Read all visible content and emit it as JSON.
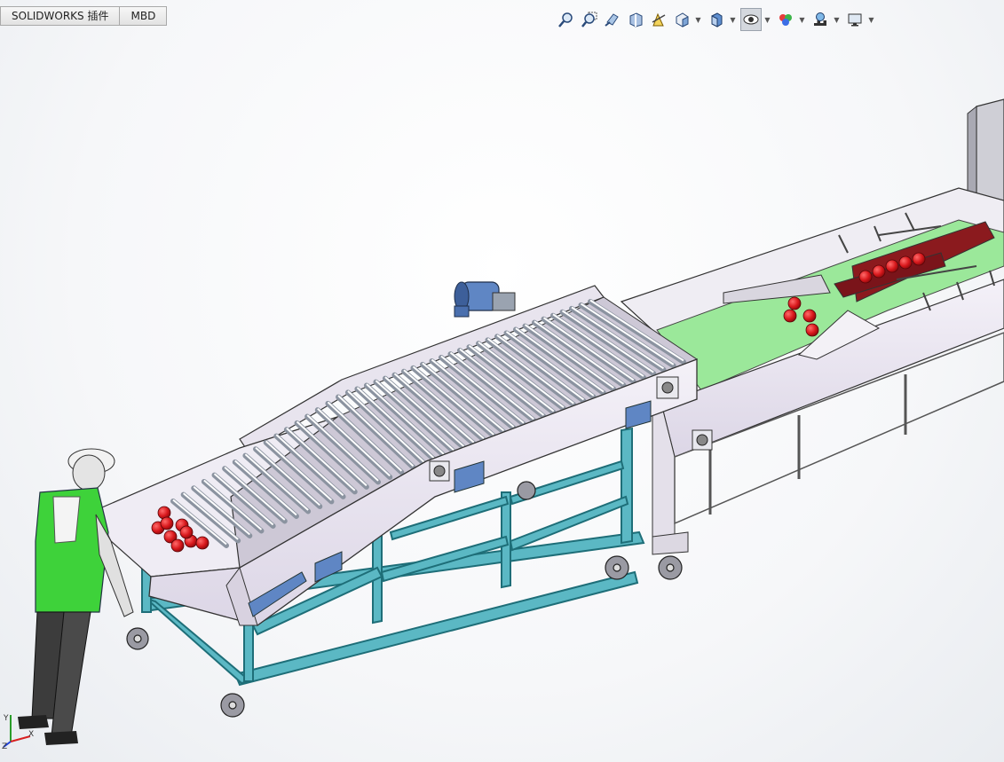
{
  "tabs": [
    {
      "label": "SOLIDWORKS 插件"
    },
    {
      "label": "MBD"
    }
  ],
  "toolbar": {
    "tools": [
      {
        "icon": "zoom-to-fit-icon"
      },
      {
        "icon": "zoom-to-area-icon"
      },
      {
        "icon": "previous-view-icon"
      },
      {
        "icon": "section-view-icon"
      },
      {
        "icon": "dynamic-annotation-icon"
      },
      {
        "icon": "view-orientation-icon",
        "dropdown": true
      },
      {
        "icon": "display-style-icon",
        "dropdown": true
      },
      {
        "icon": "hide-show-items-icon",
        "dropdown": true,
        "active": true
      },
      {
        "icon": "edit-appearance-icon",
        "dropdown": true
      },
      {
        "icon": "apply-scene-icon",
        "dropdown": true
      },
      {
        "icon": "view-settings-icon",
        "dropdown": true
      }
    ]
  },
  "triad": {
    "x_label": "X",
    "y_label": "Y",
    "z_label": "Z"
  },
  "colors": {
    "frame": "#5bb8c4",
    "conveyor": "#e6e2ee",
    "belt": "#9be89a",
    "tomato": "#d8181c",
    "motor": "#5f86c4"
  }
}
